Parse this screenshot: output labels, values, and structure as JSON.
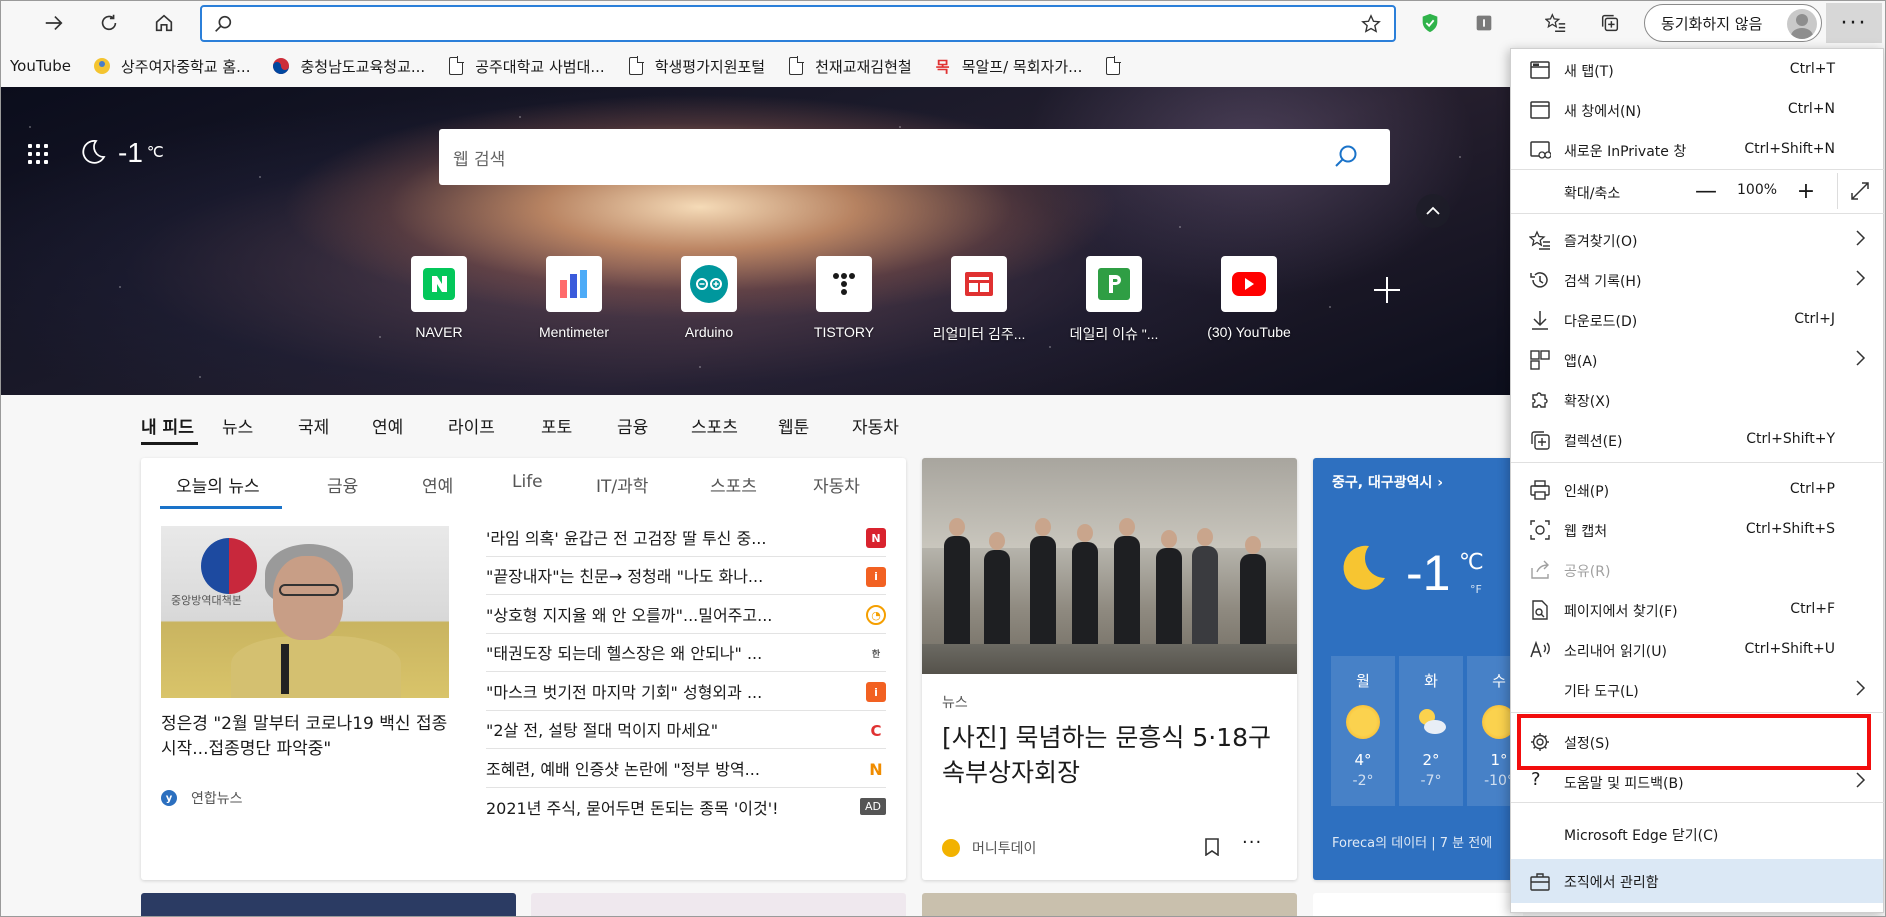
{
  "toolbar": {
    "address_value": "",
    "sync_label": "동기화하지 않음",
    "more_label": "···"
  },
  "favorites": [
    {
      "label": "YouTube",
      "icon": "youtube"
    },
    {
      "label": "상주여자중학교 홈...",
      "icon": "school-logo"
    },
    {
      "label": "충청남도교육청교...",
      "icon": "korea-flag"
    },
    {
      "label": "공주대학교 사범대...",
      "icon": "page"
    },
    {
      "label": "학생평가지원포털",
      "icon": "page"
    },
    {
      "label": "천재교재김현철",
      "icon": "page"
    },
    {
      "label": "목알프/ 목회자가...",
      "icon": "mok-logo"
    },
    {
      "label": "",
      "icon": "page"
    }
  ],
  "hero": {
    "temperature": "-1",
    "temp_unit": "℃",
    "search_placeholder": "웹 검색"
  },
  "quick_links": [
    {
      "label": "NAVER",
      "icon": "naver",
      "color": "#03c75a"
    },
    {
      "label": "Mentimeter",
      "icon": "mentimeter",
      "color": "#3b5bdb"
    },
    {
      "label": "Arduino",
      "icon": "arduino",
      "color": "#00979d"
    },
    {
      "label": "TISTORY",
      "icon": "tistory",
      "color": "#1a1a1a"
    },
    {
      "label": "리얼미터 김주...",
      "icon": "realmeter",
      "color": "#e03131"
    },
    {
      "label": "데일리 이슈 \"...",
      "icon": "daily-issue",
      "color": "#2f9e44"
    },
    {
      "label": "(30) YouTube",
      "icon": "youtube",
      "color": "#ff0000"
    }
  ],
  "category_tabs": [
    "내 피드",
    "뉴스",
    "국제",
    "연예",
    "라이프",
    "포토",
    "금융",
    "스포츠",
    "웹툰",
    "자동차"
  ],
  "news_card": {
    "tabs": [
      "오늘의 뉴스",
      "금융",
      "연예",
      "Life",
      "IT/과학",
      "스포츠",
      "자동차"
    ],
    "image_caption": "중앙방역대책본",
    "featured_title": "정은경 \"2월 말부터 코로나19 백신 접종 시작...접종명단 파악중\"",
    "featured_source": "연합뉴스",
    "headlines": [
      {
        "text": "'라임 의혹' 윤갑근 전 고검장 딸 투신 중...",
        "src": "N",
        "color": "#d9232e"
      },
      {
        "text": "\"끝장내자\"는 친문→ 정청래 \"나도 화나...",
        "src": "i",
        "color": "#f26122"
      },
      {
        "text": "\"상호형 지지율 왜 안 오를까\"...밀어주고...",
        "src": "◔",
        "color": "#f59f00"
      },
      {
        "text": "\"태권도장 되는데 헬스장은 왜 안되나\" ...",
        "src": "한",
        "color": "#555555"
      },
      {
        "text": "\"마스크 벗기전 마지막 기회\" 성형외과 ...",
        "src": "i",
        "color": "#f26122"
      },
      {
        "text": "\"2살 전, 설탕 절대 먹이지 마세요\"",
        "src": "C",
        "color": "#e03131"
      },
      {
        "text": "조혜련, 예배 인증샷 논란에 \"정부 방역...",
        "src": "N",
        "color": "#f08c00"
      },
      {
        "text": "2021년 주식, 묻어두면 돈되는 종목 '이것'!",
        "src": "AD",
        "color": "#555555"
      }
    ]
  },
  "photo_card": {
    "category": "뉴스",
    "title": "[사진] 묵념하는 문흥식 5·18구속부상자회장",
    "source": "머니투데이",
    "more_label": "···"
  },
  "weather_card": {
    "location": "중구, 대구광역시",
    "temperature": "-1",
    "unit_c": "℃",
    "unit_f": "°F",
    "days": [
      {
        "day": "월",
        "hi": "4°",
        "lo": "-2°",
        "icon": "sunny"
      },
      {
        "day": "화",
        "hi": "2°",
        "lo": "-7°",
        "icon": "partly-cloudy"
      },
      {
        "day": "수",
        "hi": "1°",
        "lo": "-10°",
        "icon": "sunny"
      }
    ],
    "footer": "Foreca의 데이터 | 7 분 전에"
  },
  "menu": {
    "items": [
      {
        "label": "새 탭(T)",
        "shortcut": "Ctrl+T",
        "icon": "new-tab"
      },
      {
        "label": "새 창에서(N)",
        "shortcut": "Ctrl+N",
        "icon": "new-window"
      },
      {
        "label": "새로운 InPrivate 창",
        "shortcut": "Ctrl+Shift+N",
        "icon": "inprivate"
      },
      {
        "label": "즐겨찾기(O)",
        "shortcut": "",
        "icon": "favorites"
      },
      {
        "label": "검색 기록(H)",
        "shortcut": "",
        "icon": "history"
      },
      {
        "label": "다운로드(D)",
        "shortcut": "Ctrl+J",
        "icon": "download"
      },
      {
        "label": "앱(A)",
        "shortcut": "",
        "icon": "apps"
      },
      {
        "label": "확장(X)",
        "shortcut": "",
        "icon": "extensions"
      },
      {
        "label": "컬렉션(E)",
        "shortcut": "Ctrl+Shift+Y",
        "icon": "collections"
      },
      {
        "label": "인쇄(P)",
        "shortcut": "Ctrl+P",
        "icon": "print"
      },
      {
        "label": "웹 캡처",
        "shortcut": "Ctrl+Shift+S",
        "icon": "web-capture"
      },
      {
        "label": "공유(R)",
        "shortcut": "",
        "icon": "share"
      },
      {
        "label": "페이지에서 찾기(F)",
        "shortcut": "Ctrl+F",
        "icon": "find"
      },
      {
        "label": "소리내어 읽기(U)",
        "shortcut": "Ctrl+Shift+U",
        "icon": "read-aloud"
      },
      {
        "label": "기타 도구(L)",
        "shortcut": "",
        "icon": "more-tools"
      },
      {
        "label": "설정(S)",
        "shortcut": "",
        "icon": "settings"
      },
      {
        "label": "도움말 및 피드백(B)",
        "shortcut": "",
        "icon": "help"
      },
      {
        "label": "Microsoft Edge 닫기(C)",
        "shortcut": "",
        "icon": "close"
      }
    ],
    "zoom": {
      "label": "확대/축소",
      "minus": "—",
      "value": "100%",
      "plus": "+"
    },
    "manage": "조직에서 관리함"
  }
}
